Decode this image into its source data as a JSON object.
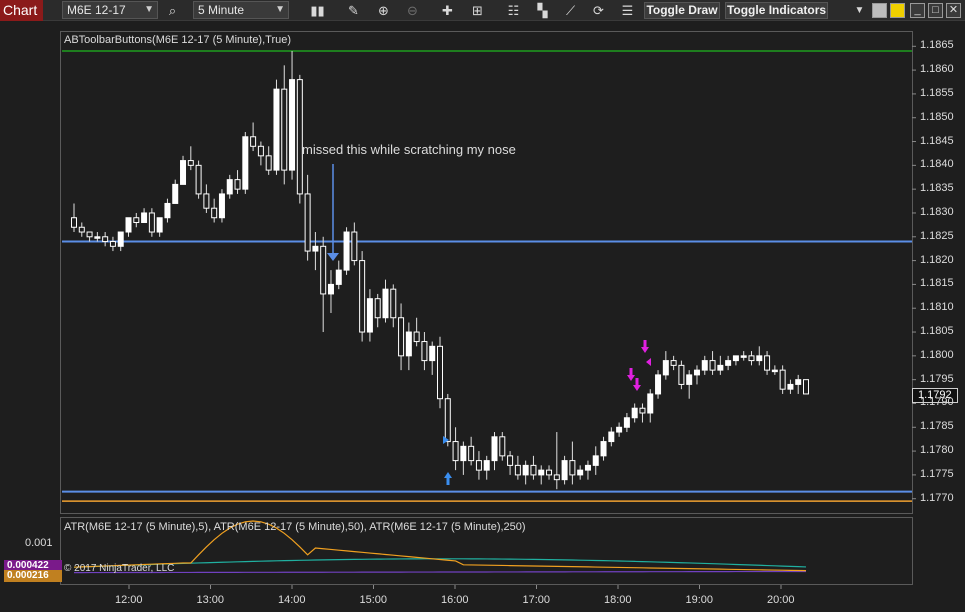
{
  "toolbar": {
    "tab_label": "Chart",
    "instrument": "M6E 12-17",
    "interval": "5 Minute",
    "toggle_draw": "Toggle Draw",
    "toggle_indicators": "Toggle Indicators",
    "icons": [
      "magnifier-icon",
      "bars-icon",
      "pencil-icon",
      "zoom-in-icon",
      "zoom-out-icon",
      "crosshair-icon",
      "data-box-icon",
      "properties-icon",
      "strategies-icon",
      "drawing-tools-icon",
      "refresh-icon",
      "list-icon",
      "dropdown-icon"
    ]
  },
  "chart": {
    "title": "ABToolbarButtons(M6E 12-17 (5 Minute),True)",
    "annotation": "missed this while scratching my nose",
    "last_price": "1.1792",
    "copyright": "© 2017 NinjaTrader, LLC",
    "price_axis": [
      "1.1865",
      "1.1860",
      "1.1855",
      "1.1850",
      "1.1845",
      "1.1840",
      "1.1835",
      "1.1830",
      "1.1825",
      "1.1820",
      "1.1815",
      "1.1810",
      "1.1805",
      "1.1800",
      "1.1795",
      "1.1790",
      "1.1785",
      "1.1780",
      "1.1775",
      "1.1770"
    ],
    "time_axis": [
      "12:00",
      "13:00",
      "14:00",
      "15:00",
      "16:00",
      "17:00",
      "18:00",
      "19:00",
      "20:00"
    ],
    "hlines": [
      {
        "price": 1.1864,
        "color": "#1e9e1e"
      },
      {
        "price": 1.1824,
        "color": "#5b8ee6"
      },
      {
        "price": 1.17715,
        "color": "#5b8ee6"
      },
      {
        "price": 1.17695,
        "color": "#f0a030"
      }
    ]
  },
  "indicator": {
    "title": "ATR(M6E 12-17 (5 Minute),5), ATR(M6E 12-17 (5 Minute),50), ATR(M6E 12-17 (5 Minute),250)",
    "axis_label": "0.001",
    "value_fast": "0.000422",
    "value_slow": "0.000216",
    "colors": {
      "fast": "#f0a020",
      "mid": "#20b0a0",
      "slow": "#7040c0"
    }
  },
  "chart_data": {
    "type": "candlestick",
    "ylim": [
      1.1767,
      1.1868
    ],
    "candles": [
      [
        1.1829,
        1.1832,
        1.1826,
        1.1827
      ],
      [
        1.1827,
        1.1828,
        1.1825,
        1.1826
      ],
      [
        1.1826,
        1.1826,
        1.1824,
        1.1825
      ],
      [
        1.1825,
        1.1826,
        1.1824,
        1.1825
      ],
      [
        1.1825,
        1.1826,
        1.1823,
        1.1824
      ],
      [
        1.1824,
        1.1825,
        1.1822,
        1.1823
      ],
      [
        1.1823,
        1.1826,
        1.1822,
        1.1826
      ],
      [
        1.1826,
        1.1829,
        1.1825,
        1.1829
      ],
      [
        1.1829,
        1.183,
        1.1827,
        1.1828
      ],
      [
        1.1828,
        1.1831,
        1.1828,
        1.183
      ],
      [
        1.183,
        1.1831,
        1.1825,
        1.1826
      ],
      [
        1.1826,
        1.1829,
        1.1825,
        1.1829
      ],
      [
        1.1829,
        1.1833,
        1.1828,
        1.1832
      ],
      [
        1.1832,
        1.1837,
        1.1832,
        1.1836
      ],
      [
        1.1836,
        1.1842,
        1.1836,
        1.1841
      ],
      [
        1.1841,
        1.1844,
        1.1839,
        1.184
      ],
      [
        1.184,
        1.1841,
        1.1833,
        1.1834
      ],
      [
        1.1834,
        1.1836,
        1.183,
        1.1831
      ],
      [
        1.1831,
        1.1833,
        1.1828,
        1.1829
      ],
      [
        1.1829,
        1.1835,
        1.1828,
        1.1834
      ],
      [
        1.1834,
        1.1838,
        1.1833,
        1.1837
      ],
      [
        1.1837,
        1.1839,
        1.1834,
        1.1835
      ],
      [
        1.1835,
        1.1847,
        1.1834,
        1.1846
      ],
      [
        1.1846,
        1.1849,
        1.1843,
        1.1844
      ],
      [
        1.1844,
        1.1845,
        1.184,
        1.1842
      ],
      [
        1.1842,
        1.1844,
        1.1838,
        1.1839
      ],
      [
        1.1839,
        1.1858,
        1.1838,
        1.1856
      ],
      [
        1.1856,
        1.1861,
        1.1836,
        1.1839
      ],
      [
        1.1839,
        1.1864,
        1.1837,
        1.1858
      ],
      [
        1.1858,
        1.1859,
        1.1832,
        1.1834
      ],
      [
        1.1834,
        1.1838,
        1.182,
        1.1822
      ],
      [
        1.1822,
        1.1826,
        1.1818,
        1.1823
      ],
      [
        1.1823,
        1.1825,
        1.1805,
        1.1813
      ],
      [
        1.1813,
        1.1818,
        1.1809,
        1.1815
      ],
      [
        1.1815,
        1.182,
        1.1814,
        1.1818
      ],
      [
        1.1818,
        1.1827,
        1.1817,
        1.1826
      ],
      [
        1.1826,
        1.1828,
        1.1819,
        1.182
      ],
      [
        1.182,
        1.1822,
        1.1803,
        1.1805
      ],
      [
        1.1805,
        1.1814,
        1.1803,
        1.1812
      ],
      [
        1.1812,
        1.1813,
        1.1806,
        1.1808
      ],
      [
        1.1808,
        1.1816,
        1.1807,
        1.1814
      ],
      [
        1.1814,
        1.1815,
        1.1806,
        1.1808
      ],
      [
        1.1808,
        1.1811,
        1.1797,
        1.18
      ],
      [
        1.18,
        1.1807,
        1.1797,
        1.1805
      ],
      [
        1.1805,
        1.1808,
        1.1802,
        1.1803
      ],
      [
        1.1803,
        1.1805,
        1.1797,
        1.1799
      ],
      [
        1.1799,
        1.1803,
        1.1796,
        1.1802
      ],
      [
        1.1802,
        1.1804,
        1.1789,
        1.1791
      ],
      [
        1.1791,
        1.1792,
        1.1781,
        1.1782
      ],
      [
        1.1782,
        1.1785,
        1.1776,
        1.1778
      ],
      [
        1.1778,
        1.1782,
        1.1775,
        1.1781
      ],
      [
        1.1781,
        1.1783,
        1.1777,
        1.1778
      ],
      [
        1.1778,
        1.178,
        1.1774,
        1.1776
      ],
      [
        1.1776,
        1.1779,
        1.1774,
        1.1778
      ],
      [
        1.1778,
        1.1784,
        1.1776,
        1.1783
      ],
      [
        1.1783,
        1.1784,
        1.1778,
        1.1779
      ],
      [
        1.1779,
        1.178,
        1.1775,
        1.1777
      ],
      [
        1.1777,
        1.1779,
        1.1774,
        1.1775
      ],
      [
        1.1775,
        1.1778,
        1.1773,
        1.1777
      ],
      [
        1.1777,
        1.1779,
        1.1774,
        1.1775
      ],
      [
        1.1775,
        1.1777,
        1.1773,
        1.1776
      ],
      [
        1.1776,
        1.1777,
        1.1774,
        1.1775
      ],
      [
        1.1775,
        1.1784,
        1.1772,
        1.1774
      ],
      [
        1.1774,
        1.1779,
        1.1773,
        1.1778
      ],
      [
        1.1778,
        1.1782,
        1.1773,
        1.1775
      ],
      [
        1.1775,
        1.1777,
        1.1774,
        1.1776
      ],
      [
        1.1776,
        1.1778,
        1.1774,
        1.1777
      ],
      [
        1.1777,
        1.1781,
        1.1775,
        1.1779
      ],
      [
        1.1779,
        1.1783,
        1.1778,
        1.1782
      ],
      [
        1.1782,
        1.1785,
        1.1781,
        1.1784
      ],
      [
        1.1784,
        1.1786,
        1.1783,
        1.1785
      ],
      [
        1.1785,
        1.1788,
        1.1784,
        1.1787
      ],
      [
        1.1787,
        1.179,
        1.1786,
        1.1789
      ],
      [
        1.1789,
        1.179,
        1.1786,
        1.1788
      ],
      [
        1.1788,
        1.1793,
        1.1786,
        1.1792
      ],
      [
        1.1792,
        1.1797,
        1.1791,
        1.1796
      ],
      [
        1.1796,
        1.1801,
        1.1795,
        1.1799
      ],
      [
        1.1799,
        1.18,
        1.1797,
        1.1798
      ],
      [
        1.1798,
        1.1799,
        1.1793,
        1.1794
      ],
      [
        1.1794,
        1.1797,
        1.1791,
        1.1796
      ],
      [
        1.1796,
        1.1798,
        1.1794,
        1.1797
      ],
      [
        1.1797,
        1.18,
        1.1796,
        1.1799
      ],
      [
        1.1799,
        1.1801,
        1.1796,
        1.1797
      ],
      [
        1.1797,
        1.18,
        1.1796,
        1.1798
      ],
      [
        1.1798,
        1.18,
        1.1797,
        1.1799
      ],
      [
        1.1799,
        1.18,
        1.1798,
        1.18
      ],
      [
        1.18,
        1.1801,
        1.1799,
        1.18
      ],
      [
        1.18,
        1.1801,
        1.1798,
        1.1799
      ],
      [
        1.1799,
        1.1802,
        1.1798,
        1.18
      ],
      [
        1.18,
        1.1801,
        1.1796,
        1.1797
      ],
      [
        1.1797,
        1.1798,
        1.1796,
        1.1797
      ],
      [
        1.1797,
        1.1798,
        1.1792,
        1.1793
      ],
      [
        1.1793,
        1.1795,
        1.1792,
        1.1794
      ],
      [
        1.1794,
        1.1796,
        1.1792,
        1.1795
      ],
      [
        1.1795,
        1.1795,
        1.1792,
        1.1792
      ]
    ]
  }
}
